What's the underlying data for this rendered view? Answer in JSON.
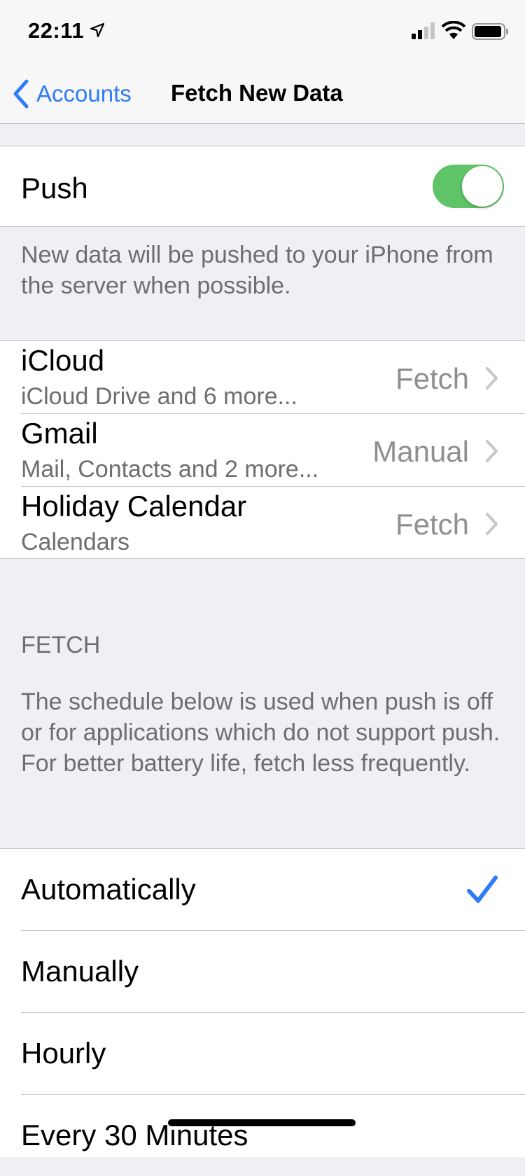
{
  "status_bar": {
    "time": "22:11",
    "icons": [
      "location-arrow-icon",
      "cellular-signal-icon",
      "wifi-icon",
      "battery-icon"
    ]
  },
  "nav": {
    "back_label": "Accounts",
    "title": "Fetch New Data"
  },
  "push": {
    "label": "Push",
    "enabled": true,
    "description": "New data will be pushed to your iPhone from the server when possible."
  },
  "accounts": [
    {
      "name": "iCloud",
      "detail": "iCloud Drive and 6 more...",
      "value": "Fetch"
    },
    {
      "name": "Gmail",
      "detail": "Mail, Contacts and 2 more...",
      "value": "Manual"
    },
    {
      "name": "Holiday Calendar",
      "detail": "Calendars",
      "value": "Fetch"
    }
  ],
  "fetch": {
    "header": "FETCH",
    "description": "The schedule below is used when push is off or for applications which do not support push. For better battery life, fetch less frequently.",
    "options": [
      {
        "label": "Automatically",
        "selected": true
      },
      {
        "label": "Manually",
        "selected": false
      },
      {
        "label": "Hourly",
        "selected": false
      },
      {
        "label": "Every 30 Minutes",
        "selected": false
      }
    ]
  },
  "colors": {
    "accent": "#2f7cf6",
    "toggle_on": "#5fc467",
    "background": "#efeff4",
    "secondary_text": "#6d6d72"
  }
}
